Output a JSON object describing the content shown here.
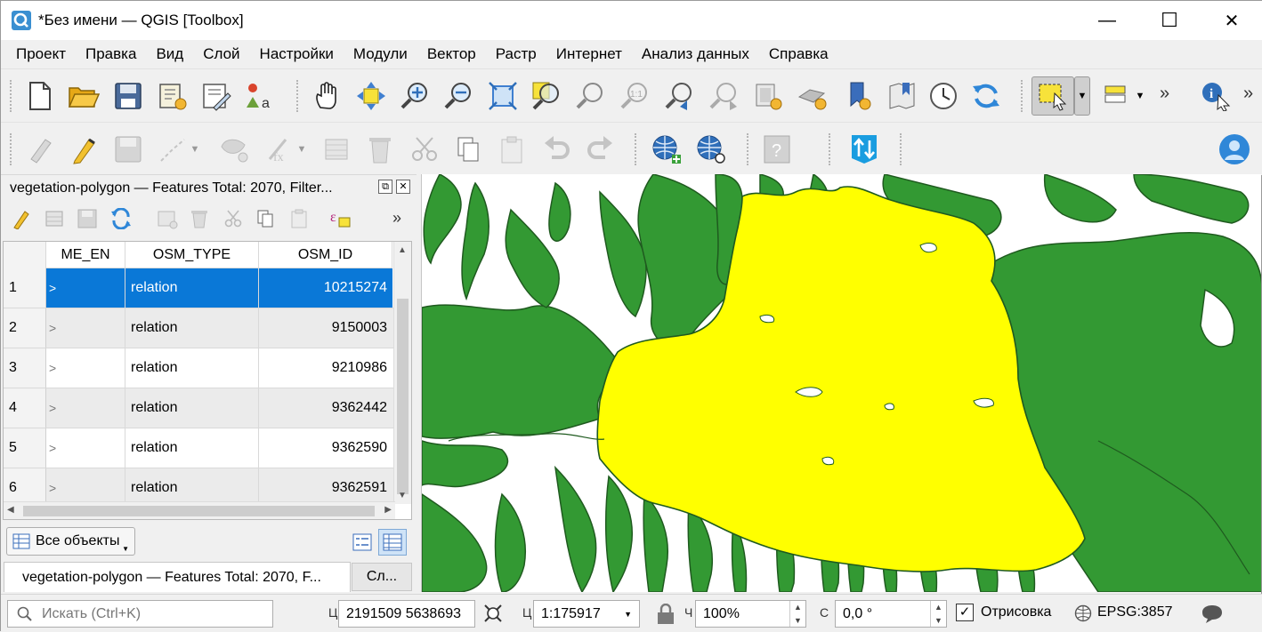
{
  "window": {
    "title": "*Без имени — QGIS [Toolbox]",
    "minimize": "—",
    "maximize": "☐",
    "close": "✕"
  },
  "menu": [
    "Проект",
    "Правка",
    "Вид",
    "Слой",
    "Настройки",
    "Модули",
    "Вектор",
    "Растр",
    "Интернет",
    "Анализ данных",
    "Справка"
  ],
  "toolbar": {
    "overflow": "»"
  },
  "attribute_table": {
    "title": "vegetation-polygon — Features Total: 2070, Filter...",
    "columns": [
      "ME_EN",
      "OSM_TYPE",
      "OSM_ID"
    ],
    "rows": [
      {
        "num": "1",
        "name": ">",
        "type": "relation",
        "id": "10215274"
      },
      {
        "num": "2",
        "name": ">",
        "type": "relation",
        "id": "9150003"
      },
      {
        "num": "3",
        "name": ">",
        "type": "relation",
        "id": "9210986"
      },
      {
        "num": "4",
        "name": ">",
        "type": "relation",
        "id": "9362442"
      },
      {
        "num": "5",
        "name": ">",
        "type": "relation",
        "id": "9362590"
      },
      {
        "num": "6",
        "name": ">",
        "type": "relation",
        "id": "9362591"
      }
    ],
    "filter_button": "Все объекты",
    "tab_active": "vegetation-polygon — Features Total: 2070, F...",
    "tab_other": "Сл..."
  },
  "map": {
    "fill_green": "#339933",
    "fill_yellow": "#ffff00",
    "stroke": "#1f5a1f"
  },
  "status": {
    "search_placeholder": "Искать (Ctrl+K)",
    "coord_label": "Ц",
    "coordinates": "2191509  5638693",
    "scale_label": "Ц",
    "scale": "1:175917",
    "magnifier_label": "Ч",
    "magnification": "100%",
    "rotation_label": "С",
    "rotation": "0,0 °",
    "render_label": "Отрисовка",
    "render_checked": "✓",
    "crs": "EPSG:3857"
  }
}
